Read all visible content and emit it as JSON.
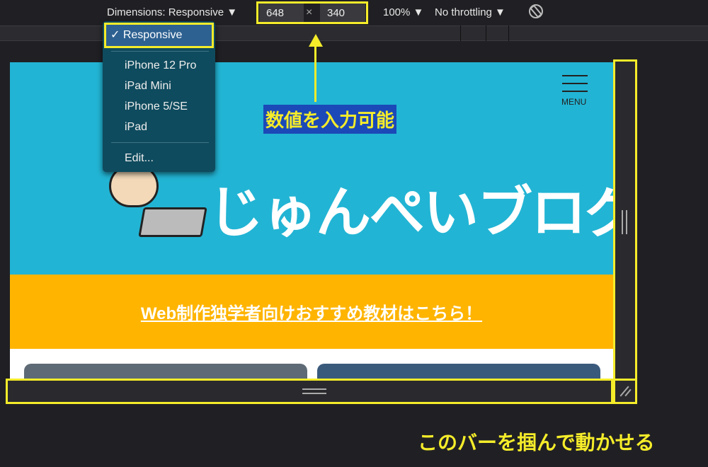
{
  "toolbar": {
    "dimensions_label": "Dimensions: Responsive ▼",
    "width": "648",
    "times": "×",
    "height": "340",
    "zoom": "100% ▼",
    "throttling": "No throttling ▼",
    "rotate_icon": "rotate-icon"
  },
  "dropdown": {
    "selected": "✓ Responsive",
    "items": [
      "iPhone 12 Pro",
      "iPad Mini",
      "iPhone 5/SE",
      "iPad"
    ],
    "edit": "Edit..."
  },
  "page": {
    "menu_label": "MENU",
    "logo_text": "じゅんぺいブログ",
    "banner_link": "Web制作独学者向けおすすめ教材はこちら！"
  },
  "annotations": {
    "input_note": "数値を入力可能",
    "bar_note": "このバーを掴んで動かせる"
  },
  "colors": {
    "header": "#22b4d4",
    "banner": "#ffb400",
    "highlight": "#f5ec2a",
    "dropdown": "#0f4b5e"
  }
}
